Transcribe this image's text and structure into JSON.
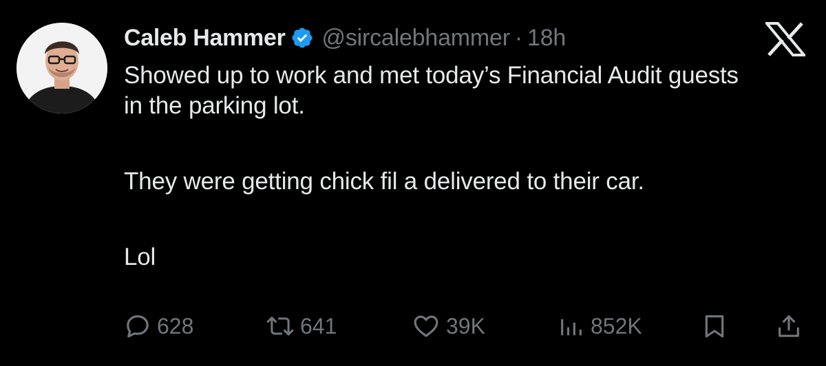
{
  "author": {
    "display_name": "Caleb Hammer",
    "handle": "@sircalebhammer",
    "separator": "·",
    "time": "18h",
    "verified": true
  },
  "tweet": {
    "paragraphs": [
      "Showed up to work and met today’s Financial Audit guests in the parking lot.",
      "They were getting chick fil a delivered to their car.",
      "Lol"
    ]
  },
  "actions": {
    "replies": "628",
    "reposts": "641",
    "likes": "39K",
    "views": "852K"
  },
  "icons": {
    "avatar": "avatar",
    "verified": "verified-badge-icon",
    "platform": "x-logo-icon",
    "reply": "reply-icon",
    "repost": "repost-icon",
    "like": "heart-icon",
    "views": "views-chart-icon",
    "bookmark": "bookmark-icon",
    "share": "share-icon"
  },
  "colors": {
    "background": "#000000",
    "text": "#e7e9ea",
    "muted": "#71767b",
    "verified": "#1d9bf0"
  }
}
